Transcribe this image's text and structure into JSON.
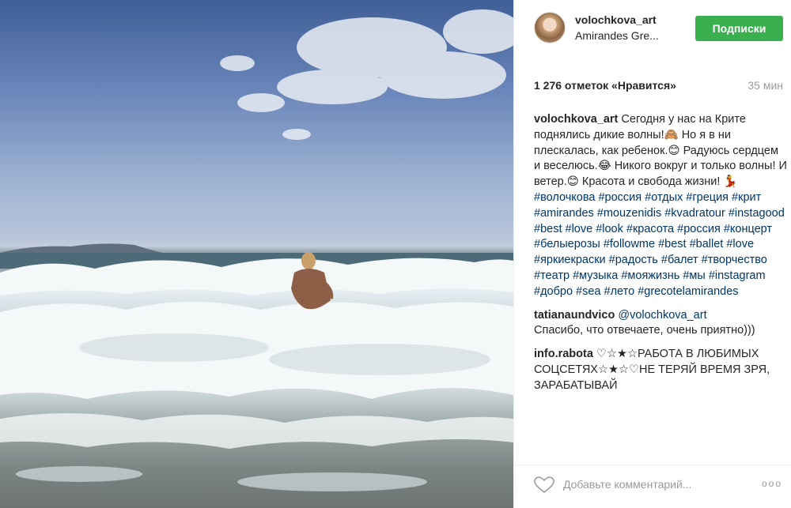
{
  "post": {
    "username": "volochkova_art",
    "location": "Amirandes Gre...",
    "follow_label": "Подписки",
    "likes": "1 276 отметок «Нравится»",
    "time": "35 мин",
    "accent_color": "#3aaf4e"
  },
  "caption": {
    "user": "volochkova_art",
    "text": "Сегодня у нас на Крите поднялись дикие волны!🙈 Но я в ни плескалась, как ребенок.😊 Радуюсь сердцем и веселюсь.😂 Никого вокруг и только волны! И ветер.😊 Красота и свобода жизни! 💃",
    "tags": "#волочкова #россия #отдых #греция #крит #amirandes #mouzenidis #kvadratour #instagood #best #love #look #красота #россия #концерт #белыерозы #followme #best #ballet #love #яркиекраски #радость #балет #творчество #театр #музыка #моя​жизнь #мы #instagram #добро #sea #лето #grecotelamirandes"
  },
  "comments": [
    {
      "user": "tatianaundvico",
      "mention": "@volochkova_art",
      "text": "Спасибо, что отвечаете, очень приятно)))"
    },
    {
      "user": "info.rabota",
      "mention": "",
      "text": "♡☆★☆РАБОТА В ЛЮБИМЫХ СОЦСЕТЯХ☆★☆♡НЕ ТЕРЯЙ ВРЕМЯ ЗРЯ, ЗАРАБАТЫВАЙ"
    }
  ],
  "footer": {
    "heart_icon": "heart-outline-icon",
    "comment_placeholder": "Добавьте комментарий...",
    "more_label": "ooo"
  }
}
